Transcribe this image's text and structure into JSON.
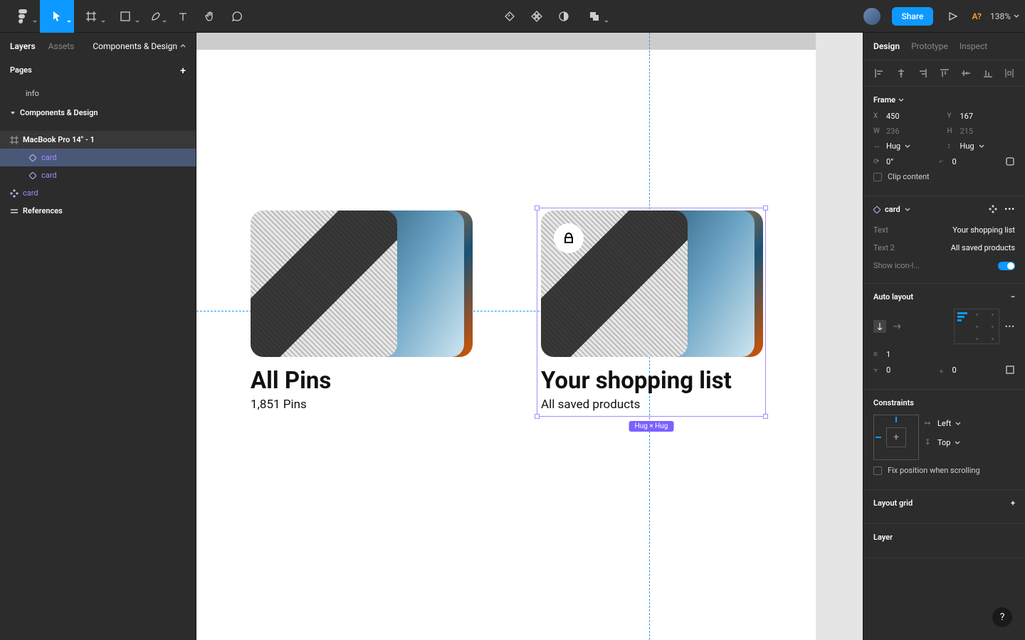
{
  "toolbar": {
    "share_label": "Share",
    "zoom": "138%",
    "badge": "A?"
  },
  "left": {
    "tabs": {
      "layers": "Layers",
      "assets": "Assets",
      "library": "Components & Design"
    },
    "pages_label": "Pages",
    "pages": [
      {
        "label": "info"
      },
      {
        "label": "Components & Design",
        "section": true
      }
    ],
    "layers": [
      {
        "label": "MacBook Pro 14\" - 1",
        "frame": true
      },
      {
        "label": "card",
        "instance": true,
        "selected": true
      },
      {
        "label": "card",
        "instance": true
      },
      {
        "label": "card",
        "component": true,
        "top": true
      },
      {
        "label": "References",
        "group": true,
        "top": true
      }
    ]
  },
  "canvas": {
    "card1": {
      "title": "All Pins",
      "subtitle": "1,851 Pins"
    },
    "card2": {
      "title": "Your shopping list",
      "subtitle": "All saved products"
    },
    "selection_label": "Hug × Hug"
  },
  "right": {
    "tabs": {
      "design": "Design",
      "prototype": "Prototype",
      "inspect": "Inspect"
    },
    "frame_label": "Frame",
    "x": "450",
    "y": "167",
    "w": "236",
    "h": "215",
    "hug_w": "Hug",
    "hug_h": "Hug",
    "rotation": "0°",
    "radius": "0",
    "clip_label": "Clip content",
    "instance_name": "card",
    "props": {
      "text_label": "Text",
      "text_val": "Your shopping list",
      "text2_label": "Text 2",
      "text2_val": "All saved products",
      "show_icon_label": "Show icon-l..."
    },
    "autolayout_label": "Auto layout",
    "al_gap": "1",
    "al_padh": "0",
    "al_padv": "0",
    "constraints_label": "Constraints",
    "constraint_h": "Left",
    "constraint_v": "Top",
    "fix_label": "Fix position when scrolling",
    "layoutgrid_label": "Layout grid",
    "layer_label": "Layer"
  }
}
